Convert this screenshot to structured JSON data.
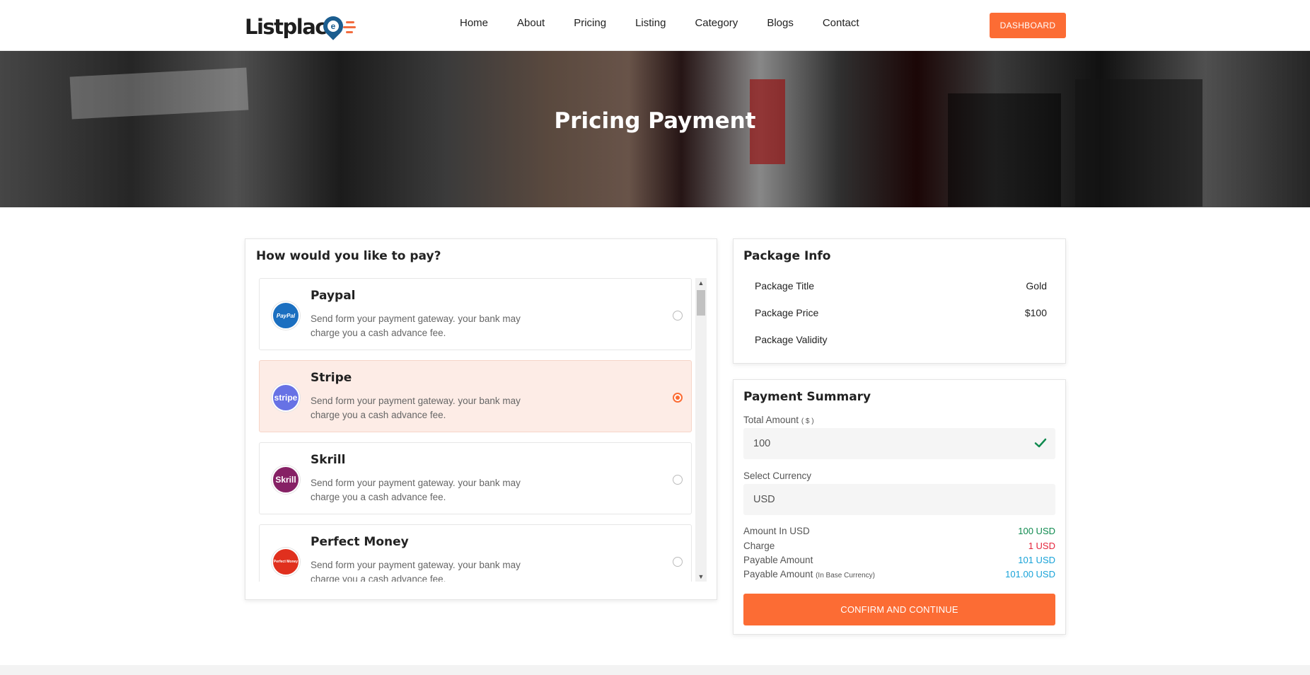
{
  "header": {
    "logo_text": "Listplac",
    "logo_letter": "e",
    "nav": [
      "Home",
      "About",
      "Pricing",
      "Listing",
      "Category",
      "Blogs",
      "Contact"
    ],
    "dashboard_label": "DASHBOARD"
  },
  "banner": {
    "title": "Pricing Payment"
  },
  "payment": {
    "heading": "How would you like to pay?",
    "methods": [
      {
        "name": "Paypal",
        "desc": "Send form your payment gateway. your bank may charge you a cash advance fee.",
        "icon": "paypal-icon",
        "icon_text": "PayPal",
        "color": "#1b6fc0",
        "selected": false
      },
      {
        "name": "Stripe",
        "desc": "Send form your payment gateway. your bank may charge you a cash advance fee.",
        "icon": "stripe-icon",
        "icon_text": "stripe",
        "color": "#6772e5",
        "selected": true
      },
      {
        "name": "Skrill",
        "desc": "Send form your payment gateway. your bank may charge you a cash advance fee.",
        "icon": "skrill-icon",
        "icon_text": "Skrill",
        "color": "#862165",
        "selected": false
      },
      {
        "name": "Perfect Money",
        "desc": "Send form your payment gateway. your bank may charge you a cash advance fee.",
        "icon": "perfect-money-icon",
        "icon_text": "Perfect Money",
        "color": "#e0301e",
        "selected": false
      }
    ]
  },
  "package": {
    "title": "Package Info",
    "rows": [
      {
        "label": "Package Title",
        "value": "Gold"
      },
      {
        "label": "Package Price",
        "value": "$100"
      },
      {
        "label": "Package Validity",
        "value": ""
      }
    ]
  },
  "summary": {
    "title": "Payment Summary",
    "total_label": "Total Amount",
    "total_unit": "( $ )",
    "total_value": "100",
    "currency_label": "Select Currency",
    "currency_value": "USD",
    "rows": [
      {
        "label": "Amount In USD",
        "sub": "",
        "value": "100 USD",
        "color": "#0f8a4f"
      },
      {
        "label": "Charge",
        "sub": "",
        "value": "1 USD",
        "color": "#e5243b"
      },
      {
        "label": "Payable Amount",
        "sub": "",
        "value": "101 USD",
        "color": "#17a2d8"
      },
      {
        "label": "Payable Amount",
        "sub": "(In Base Currency)",
        "value": "101.00 USD",
        "color": "#17a2d8"
      }
    ],
    "confirm_label": "CONFIRM AND CONTINUE"
  },
  "colors": {
    "accent": "#fc6c34",
    "selected_bg": "#fdece6",
    "success": "#0f8a4f"
  }
}
